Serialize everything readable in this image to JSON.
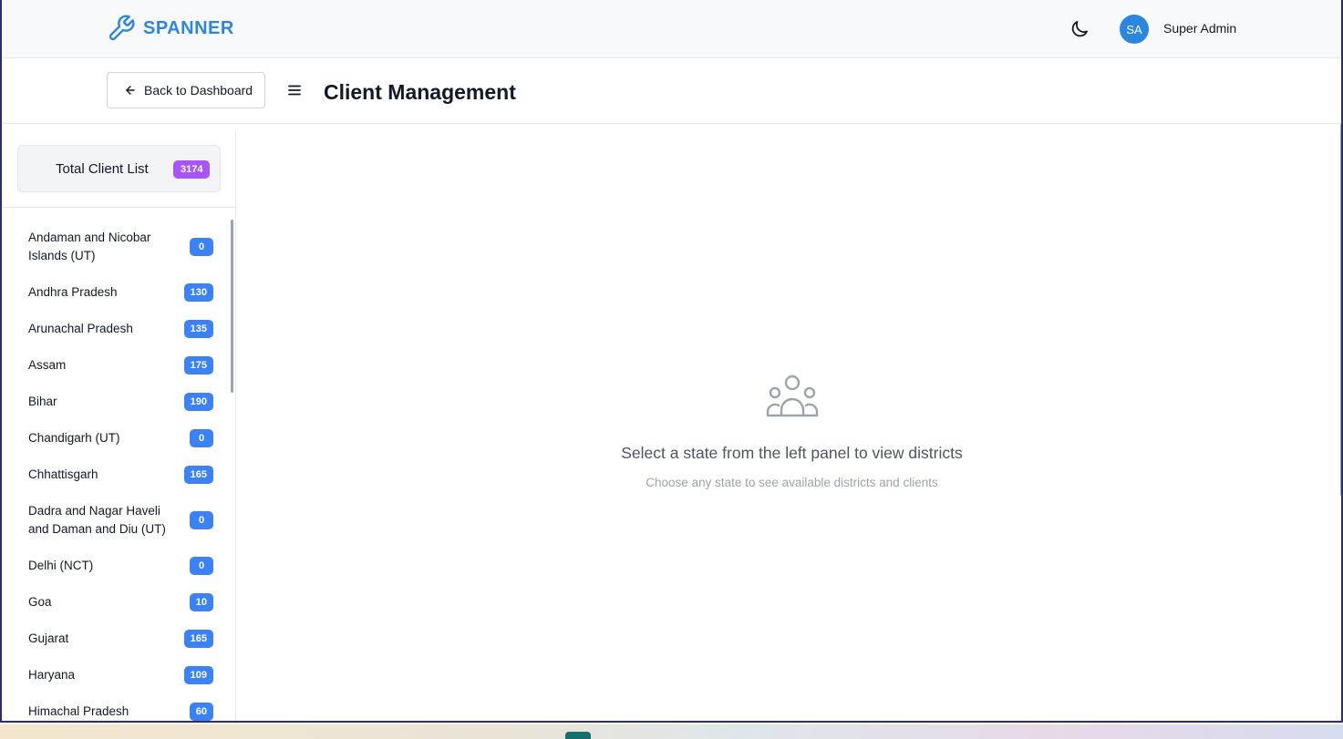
{
  "app": {
    "brand": "SPANNER"
  },
  "topbar": {
    "avatar_initials": "SA",
    "username": "Super Admin",
    "theme_icon": "moon-icon"
  },
  "header": {
    "back_label": "Back to Dashboard",
    "title": "Client Management"
  },
  "sidebar": {
    "total": {
      "label": "Total Client List",
      "count": "3174"
    },
    "states": [
      {
        "name": "Andaman and Nicobar Islands (UT)",
        "count": "0"
      },
      {
        "name": "Andhra Pradesh",
        "count": "130"
      },
      {
        "name": "Arunachal Pradesh",
        "count": "135"
      },
      {
        "name": "Assam",
        "count": "175"
      },
      {
        "name": "Bihar",
        "count": "190"
      },
      {
        "name": "Chandigarh (UT)",
        "count": "0"
      },
      {
        "name": "Chhattisgarh",
        "count": "165"
      },
      {
        "name": "Dadra and Nagar Haveli and Daman and Diu (UT)",
        "count": "0"
      },
      {
        "name": "Delhi (NCT)",
        "count": "0"
      },
      {
        "name": "Goa",
        "count": "10"
      },
      {
        "name": "Gujarat",
        "count": "165"
      },
      {
        "name": "Haryana",
        "count": "109"
      },
      {
        "name": "Himachal Pradesh",
        "count": "60"
      }
    ]
  },
  "main": {
    "empty_title": "Select a state from the left panel to view districts",
    "empty_subtitle": "Choose any state to see available districts and clients"
  },
  "colors": {
    "brand": "#2a86e0",
    "badge_blue": "#3b82f6",
    "badge_purple": "#a855f7"
  }
}
